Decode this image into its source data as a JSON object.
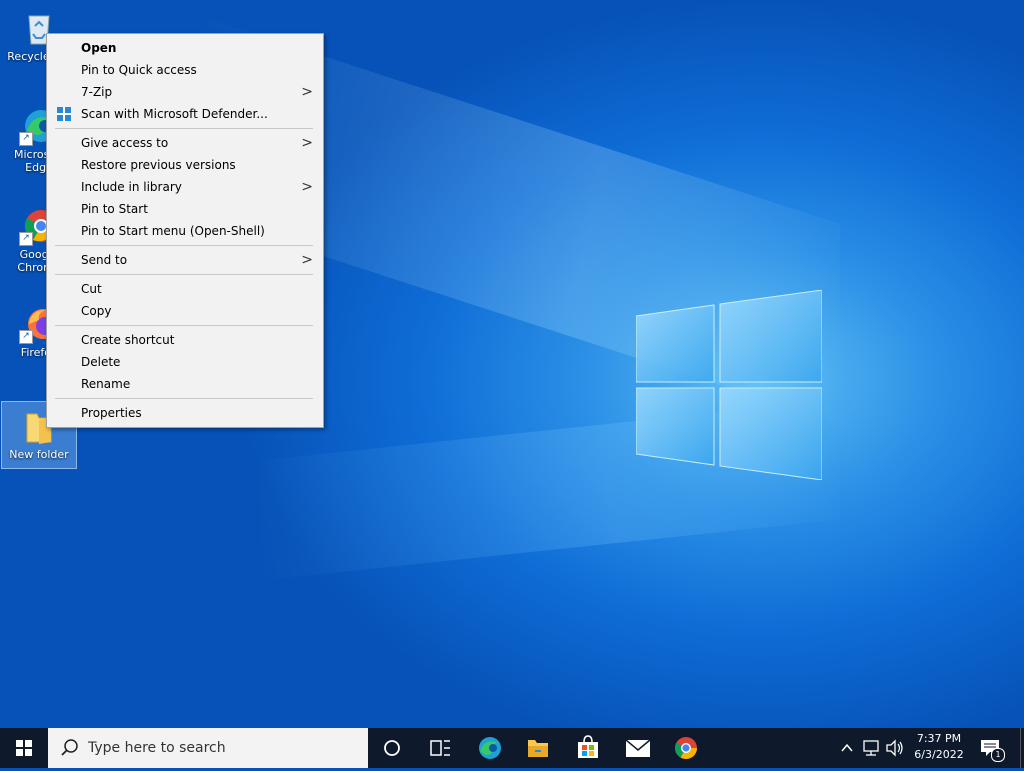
{
  "desktop": {
    "icons": [
      {
        "label": "Recycle Bin"
      },
      {
        "label": "Microsoft Edge"
      },
      {
        "label": "Google Chrome"
      },
      {
        "label": "Firefox"
      },
      {
        "label": "New folder"
      }
    ]
  },
  "context_menu": {
    "items": [
      {
        "label": "Open",
        "bold": true
      },
      {
        "label": "Pin to Quick access"
      },
      {
        "label": "7-Zip",
        "submenu": true
      },
      {
        "label": "Scan with Microsoft Defender...",
        "icon": "defender-icon"
      },
      {
        "label": "Give access to",
        "submenu": true
      },
      {
        "label": "Restore previous versions"
      },
      {
        "label": "Include in library",
        "submenu": true
      },
      {
        "label": "Pin to Start"
      },
      {
        "label": "Pin to Start menu (Open-Shell)"
      },
      {
        "label": "Send to",
        "submenu": true
      },
      {
        "label": "Cut"
      },
      {
        "label": "Copy"
      },
      {
        "label": "Create shortcut"
      },
      {
        "label": "Delete"
      },
      {
        "label": "Rename"
      },
      {
        "label": "Properties"
      }
    ],
    "submenu_arrow": ">"
  },
  "taskbar": {
    "search_placeholder": "Type here to search",
    "pinned": [
      "cortana-icon",
      "task-view-icon",
      "edge-icon",
      "file-explorer-icon",
      "store-icon",
      "mail-icon",
      "chrome-icon"
    ],
    "tray": {
      "time": "7:37 PM",
      "date": "6/3/2022",
      "notification_count": "1"
    }
  },
  "colors": {
    "taskbar": "#0e1a2b",
    "menu_bg": "#f2f2f2",
    "accent": "#0078d7"
  }
}
